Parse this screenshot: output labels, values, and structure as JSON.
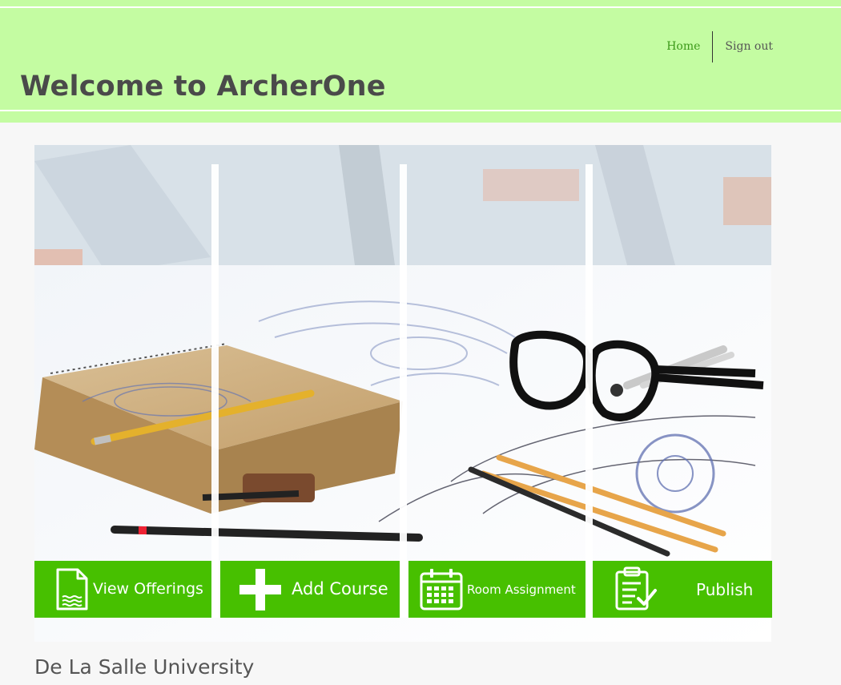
{
  "header": {
    "title": "Welcome to ArcherOne",
    "nav": {
      "home_label": "Home",
      "signout_label": "Sign out"
    }
  },
  "tiles": [
    {
      "label": "View Offerings",
      "icon": "document-icon"
    },
    {
      "label": "Add Course",
      "icon": "plus-icon"
    },
    {
      "label": "Room Assignment",
      "icon": "calendar-icon"
    },
    {
      "label": "Publish",
      "icon": "clipboard-check-icon"
    }
  ],
  "footer": {
    "institution": "De La Salle University"
  },
  "colors": {
    "header_bg": "#c4fca2",
    "tile_bg": "#47c000",
    "title_text": "#4a4a4a",
    "home_link": "#3d9a1a"
  }
}
